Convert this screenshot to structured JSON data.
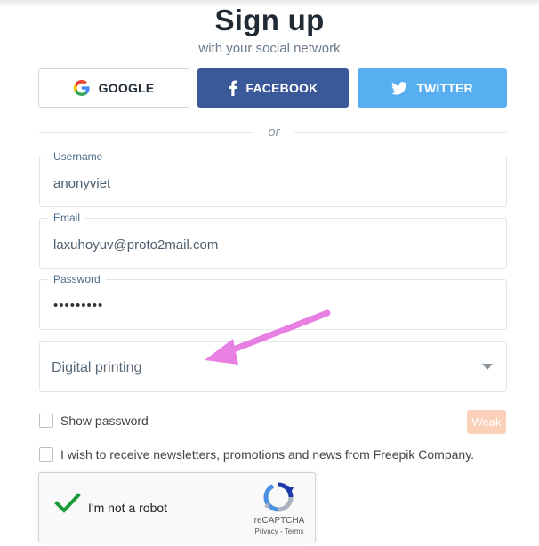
{
  "header": {
    "title": "Sign up",
    "subtitle": "with your social network"
  },
  "social": {
    "google_label": "GOOGLE",
    "facebook_label": "FACEBOOK",
    "twitter_label": "TWITTER",
    "facebook_color": "#3b5998",
    "twitter_color": "#57aff2",
    "google_icon": "google-g-icon",
    "facebook_icon": "facebook-f-icon",
    "twitter_icon": "twitter-bird-icon"
  },
  "divider": {
    "text": "or"
  },
  "form": {
    "username": {
      "label": "Username",
      "value": "anonyviet"
    },
    "email": {
      "label": "Email",
      "value": "laxuhoyuv@proto2mail.com"
    },
    "password": {
      "label": "Password",
      "value": "•••••••••"
    },
    "occupation": {
      "value": "Digital printing",
      "icon": "chevron-down-icon"
    },
    "show_password_label": "Show password",
    "strength_label": "Weak",
    "strength_color": "#fbd0b9",
    "newsletter_label": "I wish to receive newsletters, promotions and news from Freepik Company."
  },
  "recaptcha": {
    "label": "I'm not a robot",
    "brand": "reCAPTCHA",
    "terms": "Privacy - Terms",
    "check_color": "#1a9b3a"
  },
  "annotation": {
    "arrow_color": "#e87fe3"
  }
}
